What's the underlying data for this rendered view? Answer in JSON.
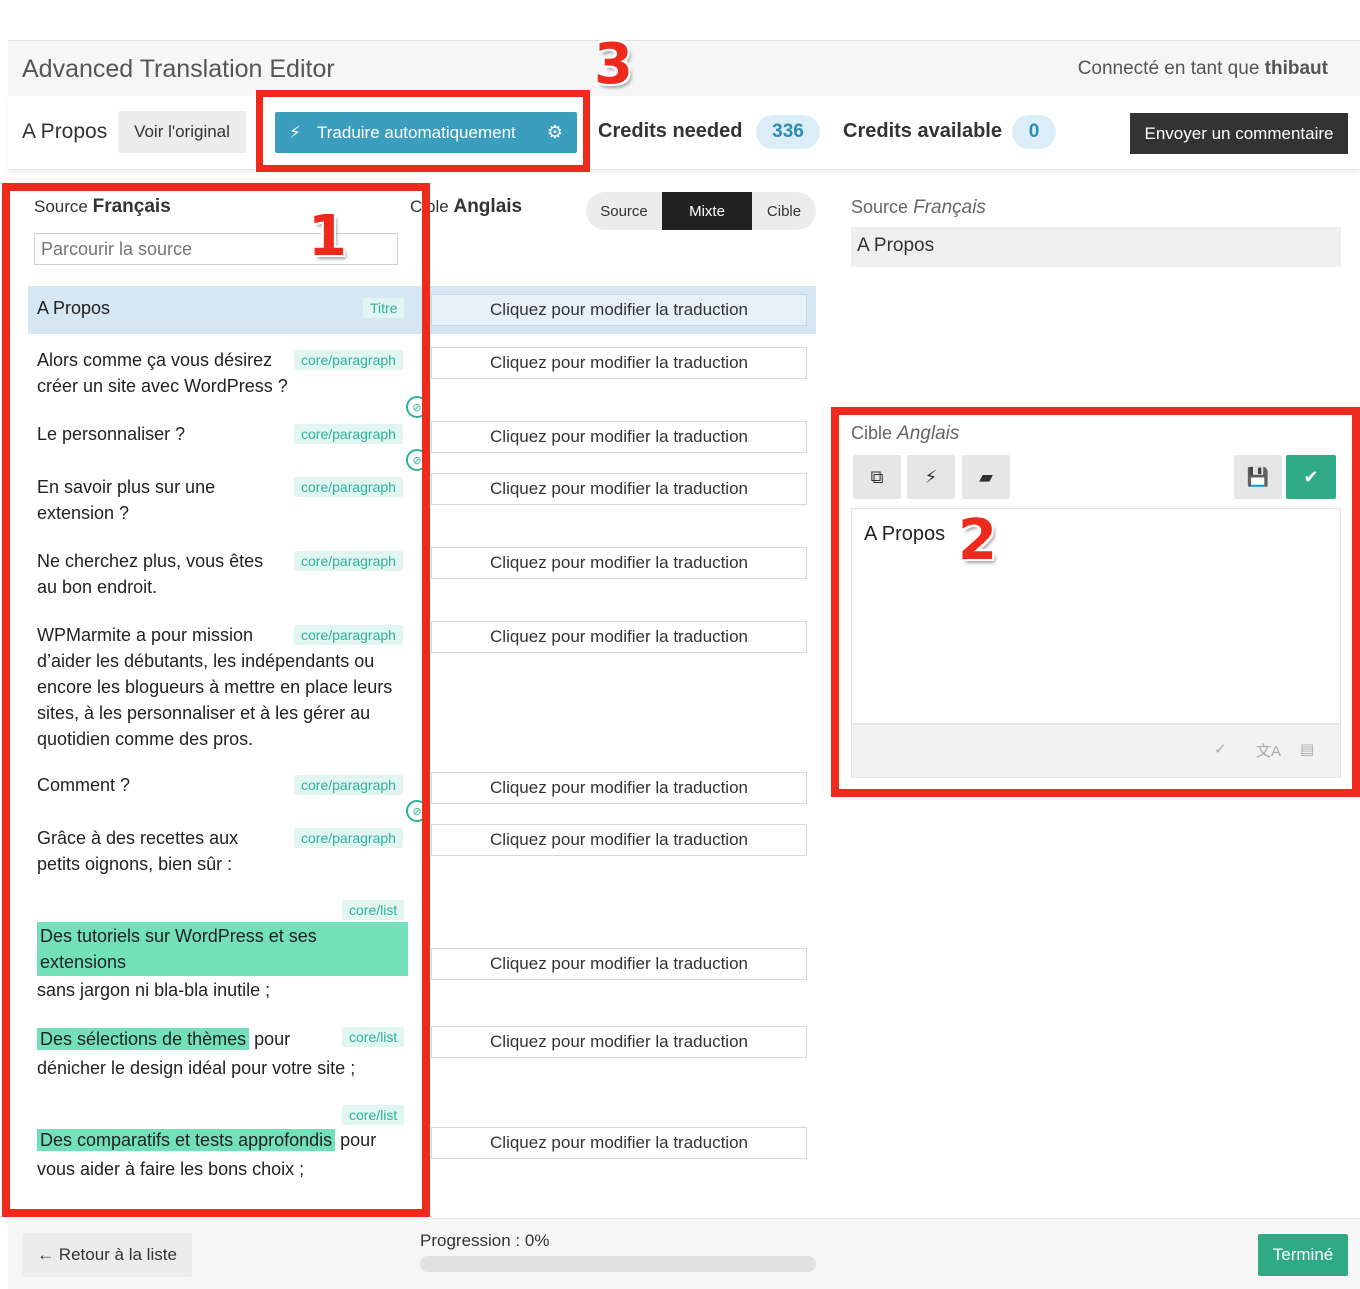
{
  "header": {
    "app_title": "Advanced Translation Editor",
    "connected_prefix": "Connecté en tant que",
    "user": "thibaut"
  },
  "toolbar": {
    "page_name": "A Propos",
    "view_original": "Voir l'original",
    "auto_translate": "Traduire automatiquement",
    "credits_needed_label": "Credits needed",
    "credits_needed": "336",
    "credits_available_label": "Credits available",
    "credits_available": "0",
    "feedback": "Envoyer un commentaire"
  },
  "annotations": {
    "n1": "1",
    "n2": "2",
    "n3": "3"
  },
  "source_panel": {
    "label": "Source",
    "language": "Français",
    "search_placeholder": "Parcourir la source"
  },
  "target_panel": {
    "label": "Cible",
    "label_visible": "ble",
    "label_occluded": "Ci",
    "language": "Anglais",
    "modes": [
      "Source",
      "Mixte",
      "Cible"
    ],
    "active_mode": "Mixte"
  },
  "segments": [
    {
      "text": "A Propos",
      "tag": "Titre",
      "placeholder": "Cliquez pour modifier la traduction"
    },
    {
      "line1": "Alors comme ça vous désirez",
      "line2": "créer un site avec WordPress ?",
      "tag": "core/paragraph",
      "placeholder": "Cliquez pour modifier la traduction"
    },
    {
      "text": "Le personnaliser ?",
      "tag": "core/paragraph",
      "placeholder": "Cliquez pour modifier la traduction"
    },
    {
      "line1": "En savoir plus sur une",
      "line2": "extension ?",
      "tag": "core/paragraph",
      "placeholder": "Cliquez pour modifier la traduction"
    },
    {
      "line1": "Ne cherchez plus, vous êtes",
      "line2": "au bon endroit.",
      "tag": "core/paragraph",
      "placeholder": "Cliquez pour modifier la traduction"
    },
    {
      "lines": [
        "WPMarmite a pour mission",
        "d’aider les débutants, les indépendants ou",
        "encore les blogueurs à mettre en place leurs",
        "sites, à les personnaliser et à les gérer au",
        "quotidien comme des pros."
      ],
      "tag": "core/paragraph",
      "placeholder": "Cliquez pour modifier la traduction"
    },
    {
      "text": "Comment ?",
      "tag": "core/paragraph",
      "placeholder": "Cliquez pour modifier la traduction"
    },
    {
      "line1": "Grâce à des recettes aux",
      "line2": "petits oignons, bien sûr :",
      "tag": "core/paragraph",
      "placeholder": "Cliquez pour modifier la traduction"
    },
    {
      "hl1": "Des tutoriels sur WordPress et ses",
      "hl2": "extensions",
      "rest": "sans jargon ni bla-bla inutile ;",
      "tag": "core/list",
      "placeholder": "Cliquez pour modifier la traduction"
    },
    {
      "hl": "Des sélections de thèmes",
      "after": "pour",
      "rest": "dénicher le design idéal pour votre site ;",
      "tag": "core/list",
      "placeholder": "Cliquez pour modifier la traduction"
    },
    {
      "hl": "Des comparatifs et tests approfondis",
      "after": "pour",
      "rest": "vous aider à faire les bons choix ;",
      "tag": "core/list",
      "placeholder": "Cliquez pour modifier la traduction"
    }
  ],
  "detail": {
    "source_label": "Source",
    "source_language": "Français",
    "source_text": "A Propos",
    "target_label": "Cible",
    "target_language": "Anglais",
    "target_text": "A Propos",
    "footer_icons": [
      "spellcheck-icon",
      "translate-icon",
      "glossary-icon"
    ]
  },
  "footer": {
    "back": "← Retour à la liste",
    "progress_label": "Progression : 0%",
    "progress": 0,
    "done": "Terminé"
  },
  "colors": {
    "accent": "#3c9ebd",
    "success": "#2faa85",
    "annotation": "#ee2a1c",
    "tag": "#2fb19a"
  }
}
